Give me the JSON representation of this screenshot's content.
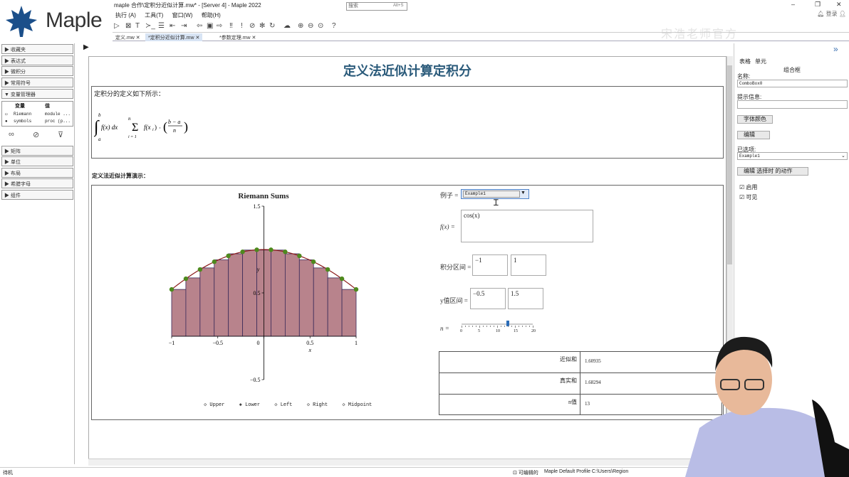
{
  "app": {
    "logo_text": "Maple",
    "title": "maple 合作\\定积分近似计算.mw* - [Server 4] - Maple 2022",
    "login": "登录",
    "watermark": "宋浩老师官方"
  },
  "menu": [
    "执行 (A)",
    "工具(T)",
    "窗口(W)",
    "帮助(H)"
  ],
  "toolbar": {
    "search_placeholder": "搜索",
    "search_shortcut": "Alt+S"
  },
  "tabs": [
    "定义.mw",
    "*定积分近似计算.mw",
    "*参数定理.mw"
  ],
  "palette": {
    "items": [
      "收藏夹",
      "表达式",
      "微积分",
      "常用符号",
      "变量管理器"
    ],
    "items_after": [
      "矩阵",
      "单位",
      "布局",
      "希腊字母",
      "组件"
    ],
    "vm_headers": [
      "变量",
      "值"
    ],
    "vm_rows": [
      [
        "Riemann",
        "module ..."
      ],
      [
        "symbols",
        "proc (p..."
      ]
    ]
  },
  "doc": {
    "title": "定义法近似计算定积分",
    "def_text": "定积分的定义如下所示：",
    "demo_label": "定义法近似计算演示："
  },
  "chart_data": {
    "type": "bar",
    "title": "Riemann Sums",
    "xlabel": "x",
    "ylabel": "y",
    "xlim": [
      -1,
      1
    ],
    "ylim": [
      -0.5,
      1.5
    ],
    "x_ticks": [
      "−1",
      "−0.5",
      "0",
      "0.5",
      "1"
    ],
    "y_ticks": [
      "1.5",
      "0.5",
      "−0.5"
    ],
    "function": "cos(x)",
    "n": 13,
    "method": "Lower",
    "bars": [
      0.54,
      0.673,
      0.788,
      0.881,
      0.951,
      0.994,
      0.994,
      0.994,
      0.951,
      0.881,
      0.788,
      0.673,
      0.54
    ],
    "curve_points_x": [
      -1,
      -0.846,
      -0.692,
      -0.538,
      -0.385,
      -0.231,
      -0.077,
      0.077,
      0.231,
      0.385,
      0.538,
      0.692,
      0.846,
      1
    ],
    "legend": [
      "Upper",
      "Lower",
      "Left",
      "Right",
      "Midpoint"
    ],
    "legend_selected": "Lower",
    "colors": {
      "bar": "#b8838c",
      "curve": "#8b1a1a",
      "points": "#4e8a1e"
    }
  },
  "controls": {
    "example_label": "例子 =",
    "example_value": "Example1",
    "f_label": "f(x) =",
    "f_value": "cos(x)",
    "interval_label": "积分区间 =",
    "interval_a": "−1",
    "interval_b": "1",
    "y_label": "y值区间 =",
    "y_a": "−0.5",
    "y_b": "1.5",
    "n_label": "n =",
    "slider_ticks": [
      "0",
      "5",
      "10",
      "15",
      "20"
    ],
    "slider_value": 13
  },
  "results": [
    {
      "label": "近似和",
      "value": "1.60935"
    },
    {
      "label": "真实和",
      "value": "1.68294"
    },
    {
      "label": "n值",
      "value": "13"
    }
  ],
  "right_panel": {
    "tabs": [
      "表格",
      "单元"
    ],
    "group": "组合框",
    "name_label": "名称:",
    "name_value": "ComboBox0",
    "tooltip_label": "提示信息:",
    "font_color_btn": "字体颜色",
    "edit_btn": "编辑",
    "selected_label": "已选项:",
    "selected_value": "Example1",
    "action_btn": "编辑 选择时 的动作",
    "enable": "启用",
    "visible": "可见"
  },
  "status": {
    "left": "待机",
    "editable": "可编辑的",
    "profile": "Maple Default Profile  C:\\Users\\Region"
  }
}
